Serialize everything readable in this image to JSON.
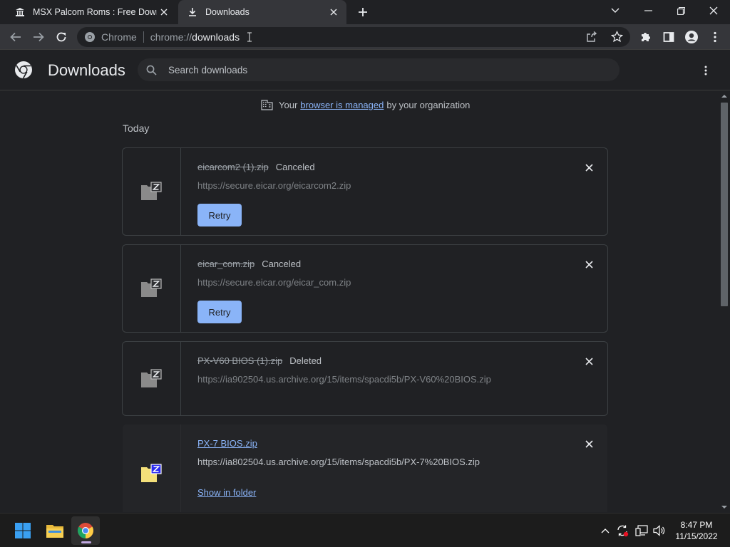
{
  "tabs": [
    {
      "title": "MSX Palcom Roms : Free Downlo",
      "icon": "museum-icon",
      "active": false
    },
    {
      "title": "Downloads",
      "icon": "download-icon",
      "active": true
    }
  ],
  "address": {
    "site": "Chrome",
    "url_prefix": "chrome://",
    "url_host": "downloads"
  },
  "page": {
    "title": "Downloads",
    "search_placeholder": "Search downloads",
    "managed_prefix": "Your",
    "managed_link": "browser is managed",
    "managed_suffix": "by your organization",
    "section": "Today"
  },
  "downloads": [
    {
      "file": "eicarcom2 (1).zip",
      "status": "Canceled",
      "url": "https://secure.eicar.org/eicarcom2.zip",
      "action": "Retry"
    },
    {
      "file": "eicar_com.zip",
      "status": "Canceled",
      "url": "https://secure.eicar.org/eicar_com.zip",
      "action": "Retry"
    },
    {
      "file": "PX-V60 BIOS (1).zip",
      "status": "Deleted",
      "url": "https://ia902504.us.archive.org/15/items/spacdi5b/PX-V60%20BIOS.zip",
      "action": ""
    },
    {
      "file": "PX-7 BIOS.zip",
      "status": "",
      "url": "https://ia802504.us.archive.org/15/items/spacdi5b/PX-7%20BIOS.zip",
      "action": "Show in folder"
    }
  ],
  "taskbar": {
    "time": "8:47 PM",
    "date": "11/15/2022"
  },
  "colors": {
    "accent": "#8ab4f8",
    "background": "#202124",
    "toolbar": "#35363a"
  }
}
